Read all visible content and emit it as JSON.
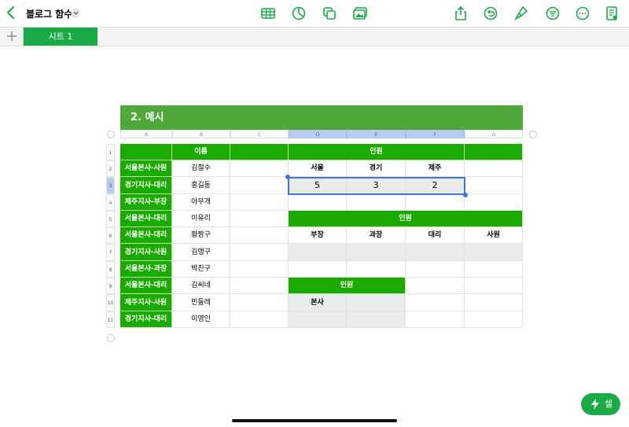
{
  "document": {
    "title": "블로그 함수"
  },
  "sheet_tabs": [
    {
      "label": "시트 1"
    }
  ],
  "table": {
    "title": "2. 예시",
    "columns": [
      "A",
      "B",
      "C",
      "D",
      "E",
      "F",
      "G"
    ],
    "rows": [
      "1",
      "2",
      "3",
      "4",
      "5",
      "6",
      "7",
      "8",
      "9",
      "10",
      "11"
    ],
    "cells": {
      "a1": "",
      "b1": "이름",
      "c1": "",
      "d1": "인원",
      "a2": "서울본사-사원",
      "b2": "김철수",
      "d2": "서울",
      "e2": "경기",
      "f2": "제주",
      "a3": "경기지사-대리",
      "b3": "홍길동",
      "d3": "5",
      "e3": "3",
      "f3": "2",
      "a4": "제주지사-부장",
      "b4": "아무개",
      "a5": "서울본사-대리",
      "b5": "이유리",
      "d5": "인원",
      "a6": "서울본사-대리",
      "b6": "황짱구",
      "d6": "부장",
      "e6": "과장",
      "f6": "대리",
      "g6": "사원",
      "a7": "경기지사-사원",
      "b7": "김맹구",
      "a8": "서울본사-과장",
      "b8": "박친구",
      "a9": "서울본사-대리",
      "b9": "김씨네",
      "d9": "인원",
      "a10": "제주지사-사원",
      "b10": "민들레",
      "d10": "본사",
      "a11": "경기지사-대리",
      "b11": "이영인"
    }
  },
  "cell_button": {
    "label": "셀"
  },
  "colors": {
    "accent": "#1aaa48",
    "header_green": "#1aaa00",
    "title_green": "#4fa83a",
    "selection": "#3b78d8"
  }
}
